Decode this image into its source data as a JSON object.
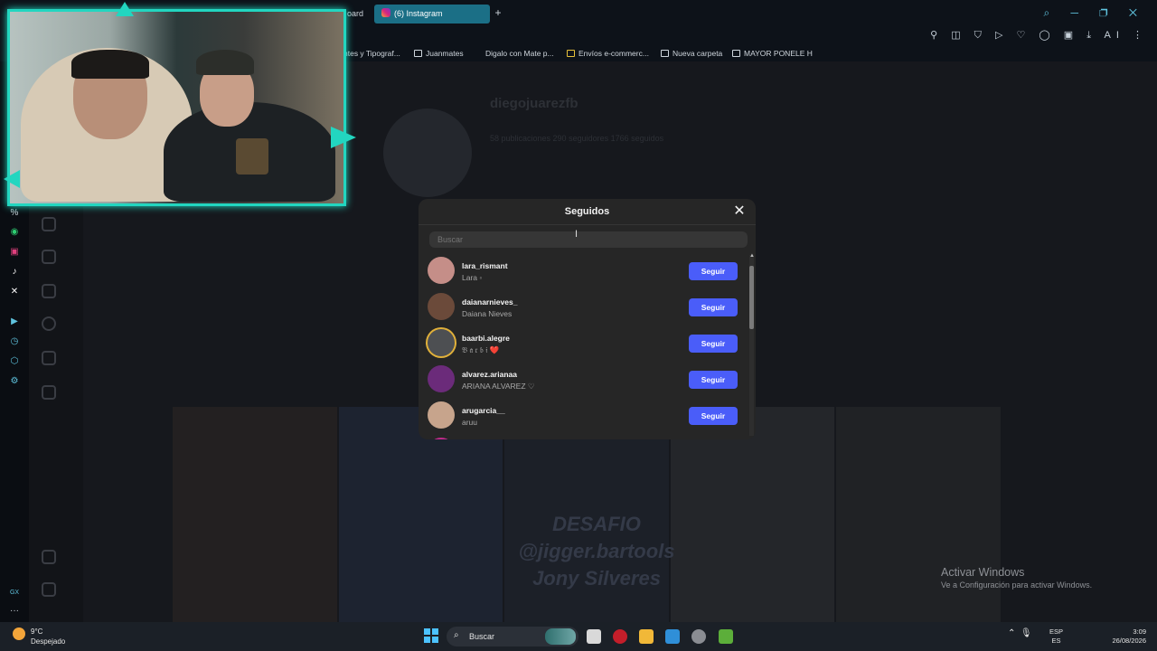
{
  "browser": {
    "tabs": [
      {
        "label": "oard",
        "active": false
      },
      {
        "label": "(6) Instagram",
        "active": true
      }
    ],
    "new_tab": "+",
    "bookmarks": [
      "ntes y Tipograf...",
      "Juanmates",
      "Digalo con Mate p...",
      "Envíos e-commerc...",
      "Nueva carpeta",
      "MAYOR PONELE H"
    ],
    "toolbar_ai": "AI"
  },
  "sidebar": {
    "label_top": "%",
    "label_bottom": "GX",
    "more": "···",
    "icons": [
      "whatsapp-icon",
      "instagram-icon",
      "tiktok-icon",
      "x-icon",
      "player-icon",
      "history-icon",
      "extensions-icon",
      "settings-icon"
    ]
  },
  "profile": {
    "username": "diegojuarezfb",
    "stats": "58 publicaciones   290 seguidores   1766 seguidos"
  },
  "post_overlay": {
    "line1": "DESAFIO",
    "line2": "@jigger.bartools",
    "line3": "Jony Silveres"
  },
  "modal": {
    "title": "Seguidos",
    "close": "✕",
    "search_placeholder": "Buscar",
    "follow_label": "Seguir",
    "users": [
      {
        "username": "lara_rismant",
        "name": "Lara ◦",
        "avatar_color": "#c58e88"
      },
      {
        "username": "daianarnieves_",
        "name": "Daiana Nieves",
        "avatar_color": "#6b4a3a"
      },
      {
        "username": "baarbi.alegre",
        "name": "𝔅 𝔞 𝔯 𝔟 𝔦 ❤️",
        "avatar_color": "#4d4f52"
      },
      {
        "username": "alvarez.arianaa",
        "name": "ARIANA ALVAREZ ♡",
        "avatar_color": "#6b2b7a"
      },
      {
        "username": "arugarcia__",
        "name": "aruu",
        "avatar_color": "#c7a48c"
      }
    ]
  },
  "activation": {
    "title": "Activar Windows",
    "subtitle": "Ve a Configuración para activar Windows."
  },
  "taskbar": {
    "weather_temp": "9°C",
    "weather_desc": "Despejado",
    "search_label": "Buscar",
    "lang_top": "ESP",
    "lang_bottom": "ES",
    "time": "3:09",
    "date": "26/08/2026"
  },
  "colors": {
    "accent": "#22d6c0",
    "follow_button": "#4a5df9",
    "modal_bg": "#262626"
  }
}
